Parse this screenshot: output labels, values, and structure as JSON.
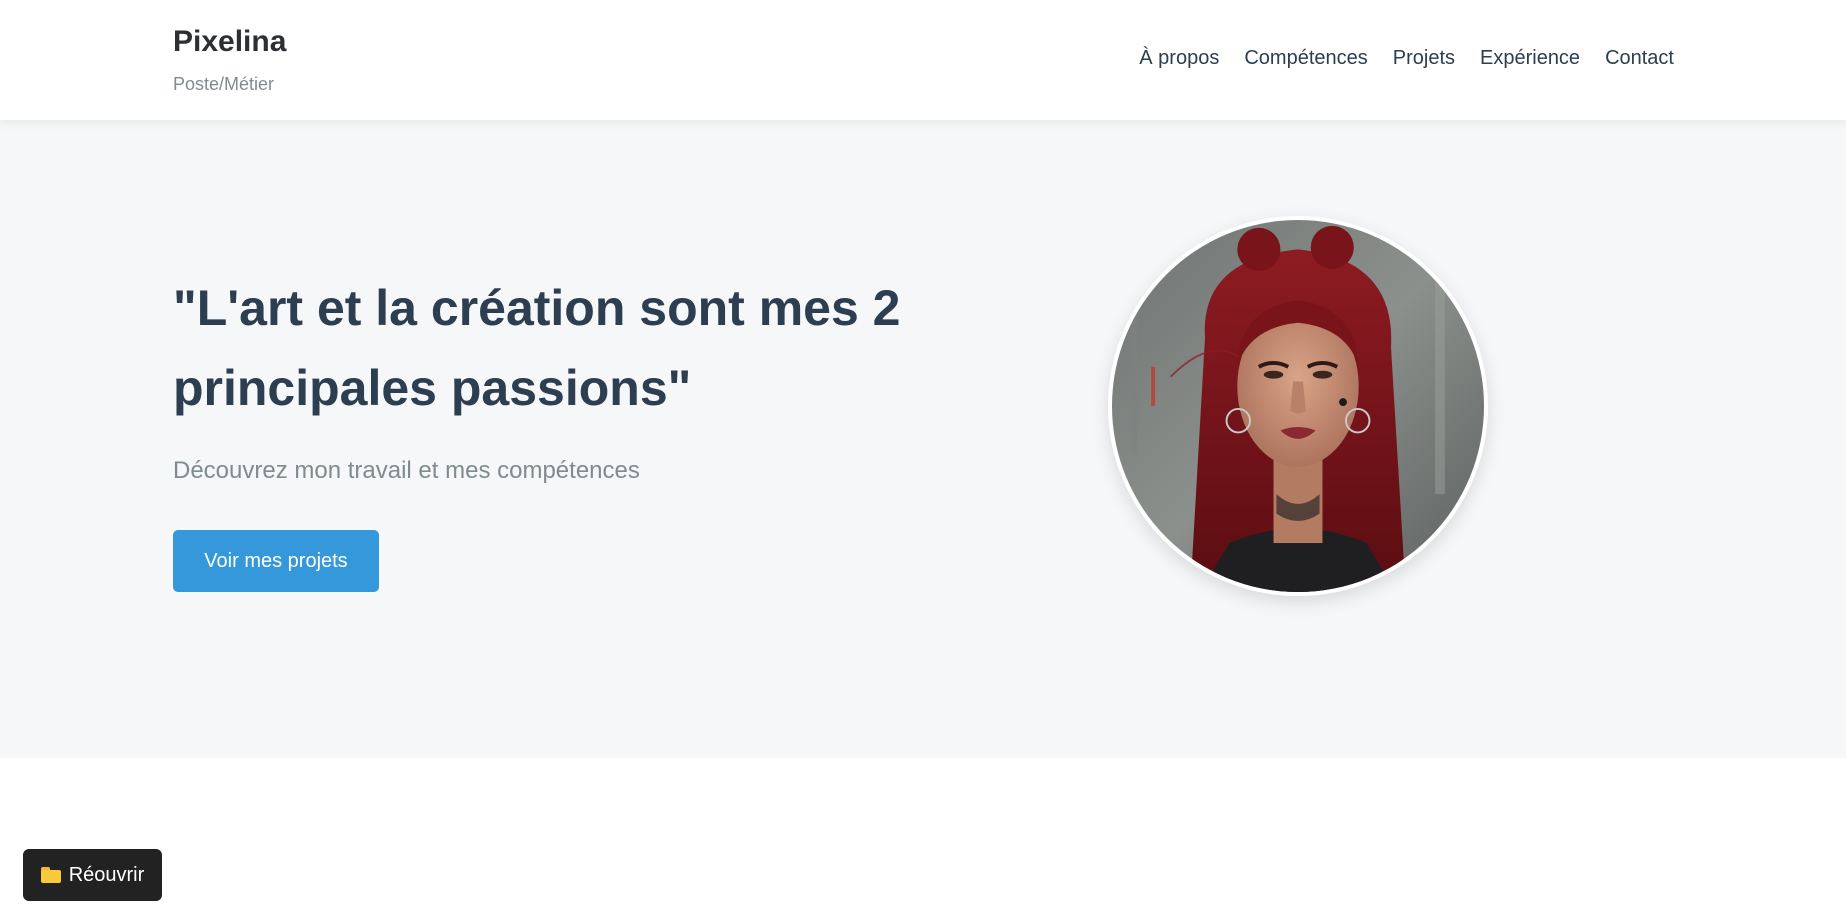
{
  "header": {
    "brand_name": "Pixelina",
    "brand_tagline": "Poste/Métier",
    "nav": [
      {
        "label": "À propos"
      },
      {
        "label": "Compétences"
      },
      {
        "label": "Projets"
      },
      {
        "label": "Expérience"
      },
      {
        "label": "Contact"
      }
    ]
  },
  "hero": {
    "title": "\"L'art et la création sont mes 2 principales passions\"",
    "subtitle": "Découvrez mon travail et mes compétences",
    "cta_label": "Voir mes projets",
    "portrait_alt": "portrait"
  },
  "floating": {
    "reopen_label": "Réouvrir",
    "icon": "folder-icon"
  },
  "colors": {
    "primary": "#3498db",
    "heading": "#2c3e50",
    "muted": "#7f8c8d",
    "hero_bg": "#f5f7f9",
    "floating_bg": "#222222"
  }
}
